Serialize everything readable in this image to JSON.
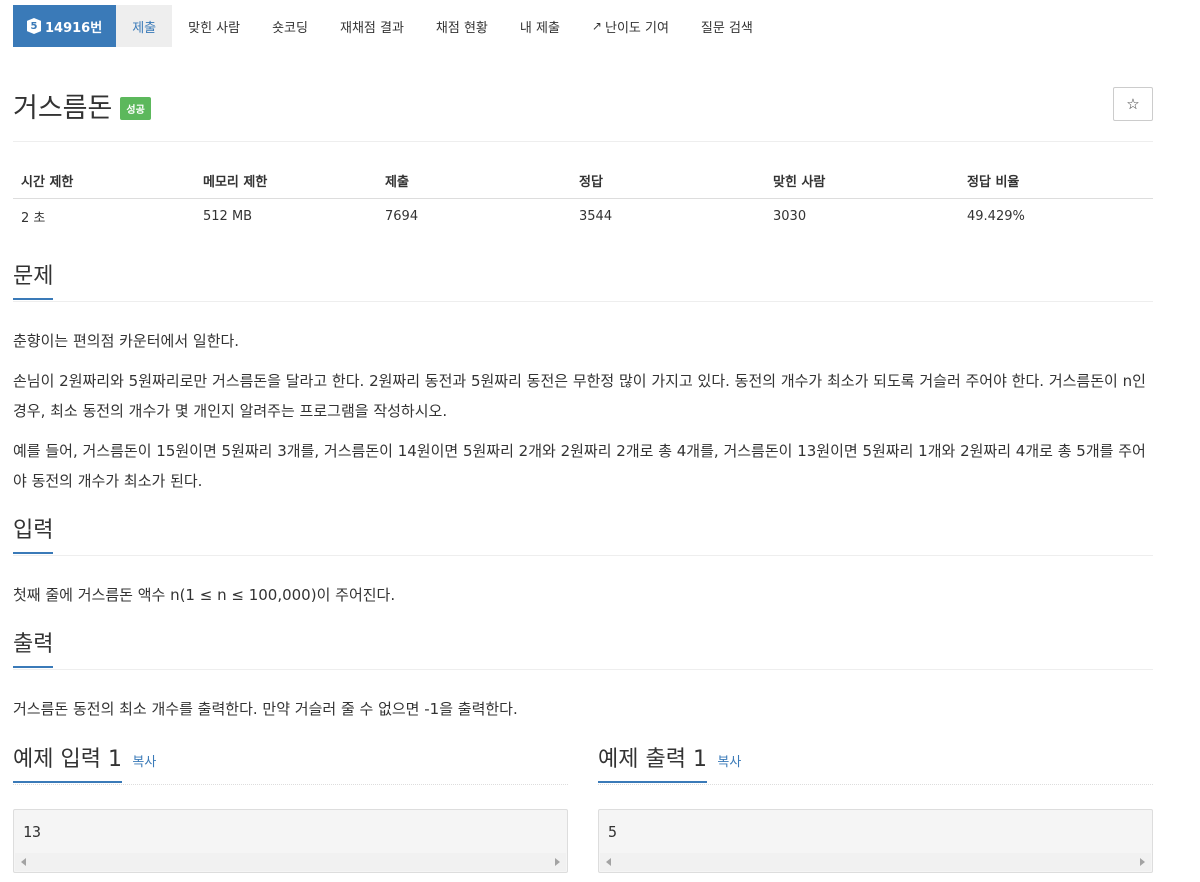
{
  "tabs": {
    "problem_tier": "5",
    "problem_number": "14916번",
    "items": [
      "제출",
      "맞힌 사람",
      "숏코딩",
      "재채점 결과",
      "채점 현황",
      "내 제출",
      "난이도 기여",
      "질문 검색"
    ]
  },
  "problem": {
    "title": "거스름돈",
    "badge": "성공",
    "star": "☆"
  },
  "info": {
    "headers": [
      "시간 제한",
      "메모리 제한",
      "제출",
      "정답",
      "맞힌 사람",
      "정답 비율"
    ],
    "values": [
      "2 초",
      "512 MB",
      "7694",
      "3544",
      "3030",
      "49.429%"
    ]
  },
  "description": {
    "heading": "문제",
    "paragraphs": [
      "춘향이는 편의점 카운터에서 일한다.",
      "손님이 2원짜리와 5원짜리로만 거스름돈을 달라고 한다. 2원짜리 동전과 5원짜리 동전은 무한정 많이 가지고 있다. 동전의 개수가 최소가 되도록 거슬러 주어야 한다. 거스름돈이 n인 경우, 최소 동전의 개수가 몇 개인지 알려주는 프로그램을 작성하시오.",
      "예를 들어, 거스름돈이 15원이면 5원짜리 3개를, 거스름돈이 14원이면 5원짜리 2개와 2원짜리 2개로 총 4개를, 거스름돈이 13원이면 5원짜리 1개와 2원짜리 4개로 총 5개를 주어야 동전의 개수가 최소가 된다."
    ]
  },
  "input": {
    "heading": "입력",
    "text": "첫째 줄에 거스름돈 액수 n(1 ≤ n ≤ 100,000)이 주어진다."
  },
  "output": {
    "heading": "출력",
    "text": "거스름돈 동전의 최소 개수를 출력한다. 만약 거슬러 줄 수 없으면 -1을 출력한다."
  },
  "samples": {
    "input_heading": "예제 입력 1",
    "output_heading": "예제 출력 1",
    "copy_label": "복사",
    "input_value": "13",
    "output_value": "5"
  },
  "colors": {
    "accent": "#3a7ab8",
    "success": "#5cb85c"
  }
}
